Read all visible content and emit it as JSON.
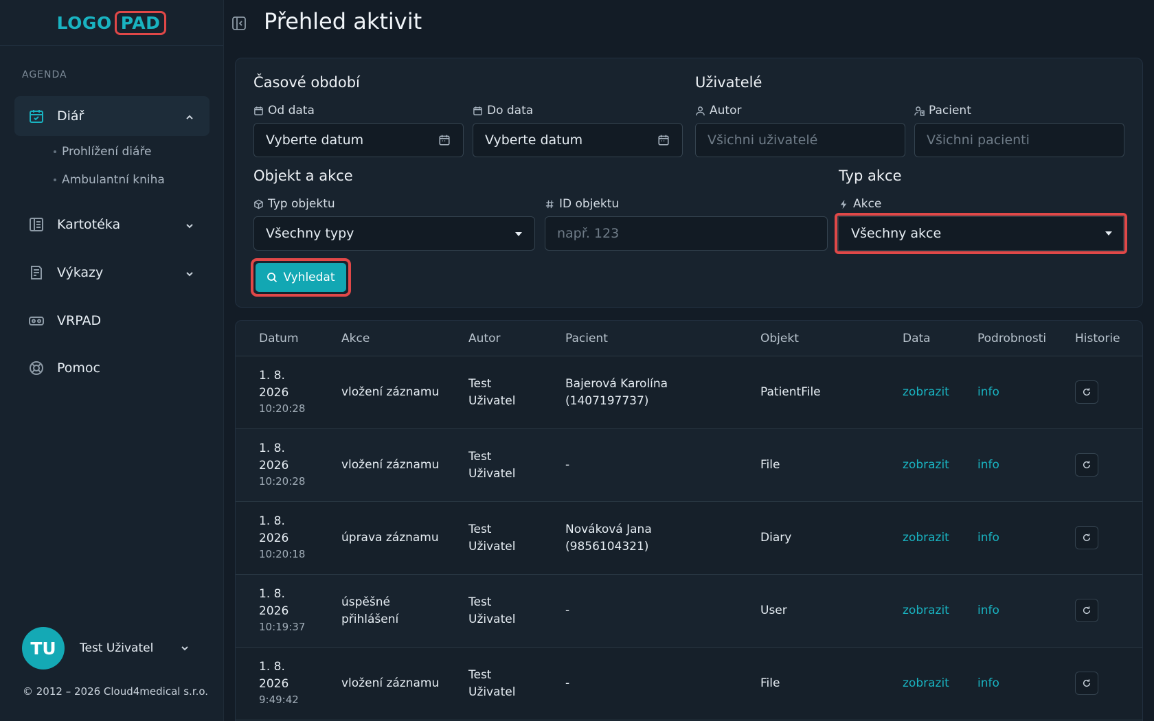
{
  "sidebar": {
    "logo": {
      "part1": "LOGO",
      "part2": "PAD"
    },
    "section_label": "AGENDA",
    "items": [
      {
        "label": "Diář",
        "icon": "calendar-check-icon",
        "active": true,
        "expanded": true,
        "children": [
          {
            "label": "Prohlížení diáře"
          },
          {
            "label": "Ambulantní kniha"
          }
        ]
      },
      {
        "label": "Kartotéka",
        "icon": "book-icon"
      },
      {
        "label": "Výkazy",
        "icon": "report-icon"
      },
      {
        "label": "VRPAD",
        "icon": "vr-headset-icon"
      },
      {
        "label": "Pomoc",
        "icon": "lifebuoy-icon"
      }
    ],
    "user": {
      "initials": "TU",
      "name": "Test Uživatel"
    },
    "copyright": "© 2012 – 2026 Cloud4medical s.r.o."
  },
  "header": {
    "title": "Přehled aktivit"
  },
  "filter": {
    "time_group": "Časové období",
    "from_label": "Od data",
    "from_value": "Vyberte datum",
    "to_label": "Do data",
    "to_value": "Vyberte datum",
    "users_group": "Uživatelé",
    "author_label": "Autor",
    "author_placeholder": "Všichni uživatelé",
    "patient_label": "Pacient",
    "patient_placeholder": "Všichni pacienti",
    "object_group": "Objekt a akce",
    "object_type_label": "Typ objektu",
    "object_type_value": "Všechny typy",
    "object_id_label": "ID objektu",
    "object_id_placeholder": "např. 123",
    "action_group": "Typ akce",
    "action_label": "Akce",
    "action_value": "Všechny akce",
    "search_label": "Vyhledat"
  },
  "table": {
    "columns": [
      "Datum",
      "Akce",
      "Autor",
      "Pacient",
      "Objekt",
      "Data",
      "Podrobnosti",
      "Historie"
    ],
    "rows": [
      {
        "date": "1. 8.",
        "year": "2026",
        "time": "10:20:28",
        "action1": "vložení záznamu",
        "action2": "",
        "author1": "Test",
        "author2": "Uživatel",
        "patient1": "Bajerová Karolína",
        "patient2": "(1407197737)",
        "object": "PatientFile",
        "data": "zobrazit",
        "details": "info"
      },
      {
        "date": "1. 8.",
        "year": "2026",
        "time": "10:20:28",
        "action1": "vložení záznamu",
        "action2": "",
        "author1": "Test",
        "author2": "Uživatel",
        "patient1": "-",
        "patient2": "",
        "object": "File",
        "data": "zobrazit",
        "details": "info"
      },
      {
        "date": "1. 8.",
        "year": "2026",
        "time": "10:20:18",
        "action1": "úprava záznamu",
        "action2": "",
        "author1": "Test",
        "author2": "Uživatel",
        "patient1": "Nováková Jana",
        "patient2": "(9856104321)",
        "object": "Diary",
        "data": "zobrazit",
        "details": "info"
      },
      {
        "date": "1. 8.",
        "year": "2026",
        "time": "10:19:37",
        "action1": "úspěšné",
        "action2": "přihlášení",
        "author1": "Test",
        "author2": "Uživatel",
        "patient1": "-",
        "patient2": "",
        "object": "User",
        "data": "zobrazit",
        "details": "info"
      },
      {
        "date": "1. 8.",
        "year": "2026",
        "time": "9:49:42",
        "action1": "vložení záznamu",
        "action2": "",
        "author1": "Test",
        "author2": "Uživatel",
        "patient1": "-",
        "patient2": "",
        "object": "File",
        "data": "zobrazit",
        "details": "info"
      }
    ]
  },
  "colors": {
    "accent": "#19b3c1",
    "highlight": "#e04848",
    "background": "#131c26"
  }
}
